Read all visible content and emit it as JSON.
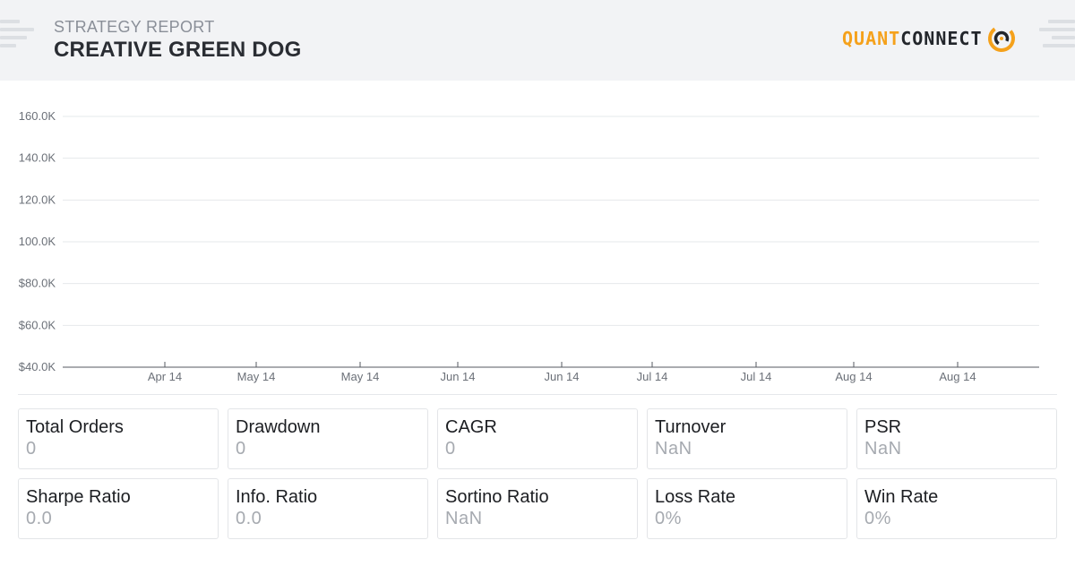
{
  "header": {
    "report_label": "STRATEGY REPORT",
    "title": "CREATIVE GREEN DOG",
    "logo": {
      "part1": "QUANT",
      "part2": "CONNECT",
      "icon": "quantconnect-logo-icon"
    }
  },
  "chart_data": {
    "type": "line",
    "y_ticks": [
      "160.0K",
      "140.0K",
      "120.0K",
      "100.0K",
      "$80.0K",
      "$60.0K",
      "$40.0K"
    ],
    "x_ticks": [
      "Apr 14",
      "May 14",
      "May 14",
      "Jun 14",
      "Jun 14",
      "Jul 14",
      "Jul 14",
      "Aug 14",
      "Aug 14"
    ],
    "ylim": [
      40000,
      160000
    ],
    "grid": true,
    "series": []
  },
  "stats": [
    {
      "label": "Total Orders",
      "value": "0"
    },
    {
      "label": "Drawdown",
      "value": "0"
    },
    {
      "label": "CAGR",
      "value": "0"
    },
    {
      "label": "Turnover",
      "value": "NaN"
    },
    {
      "label": "PSR",
      "value": "NaN"
    },
    {
      "label": "Sharpe Ratio",
      "value": "0.0"
    },
    {
      "label": "Info. Ratio",
      "value": "0.0"
    },
    {
      "label": "Sortino Ratio",
      "value": "NaN"
    },
    {
      "label": "Loss Rate",
      "value": "0%"
    },
    {
      "label": "Win Rate",
      "value": "0%"
    }
  ],
  "colors": {
    "accent": "#f5a11b",
    "header_bg": "#f2f3f5",
    "grid": "#e6e8eb",
    "axis": "#555a61"
  }
}
